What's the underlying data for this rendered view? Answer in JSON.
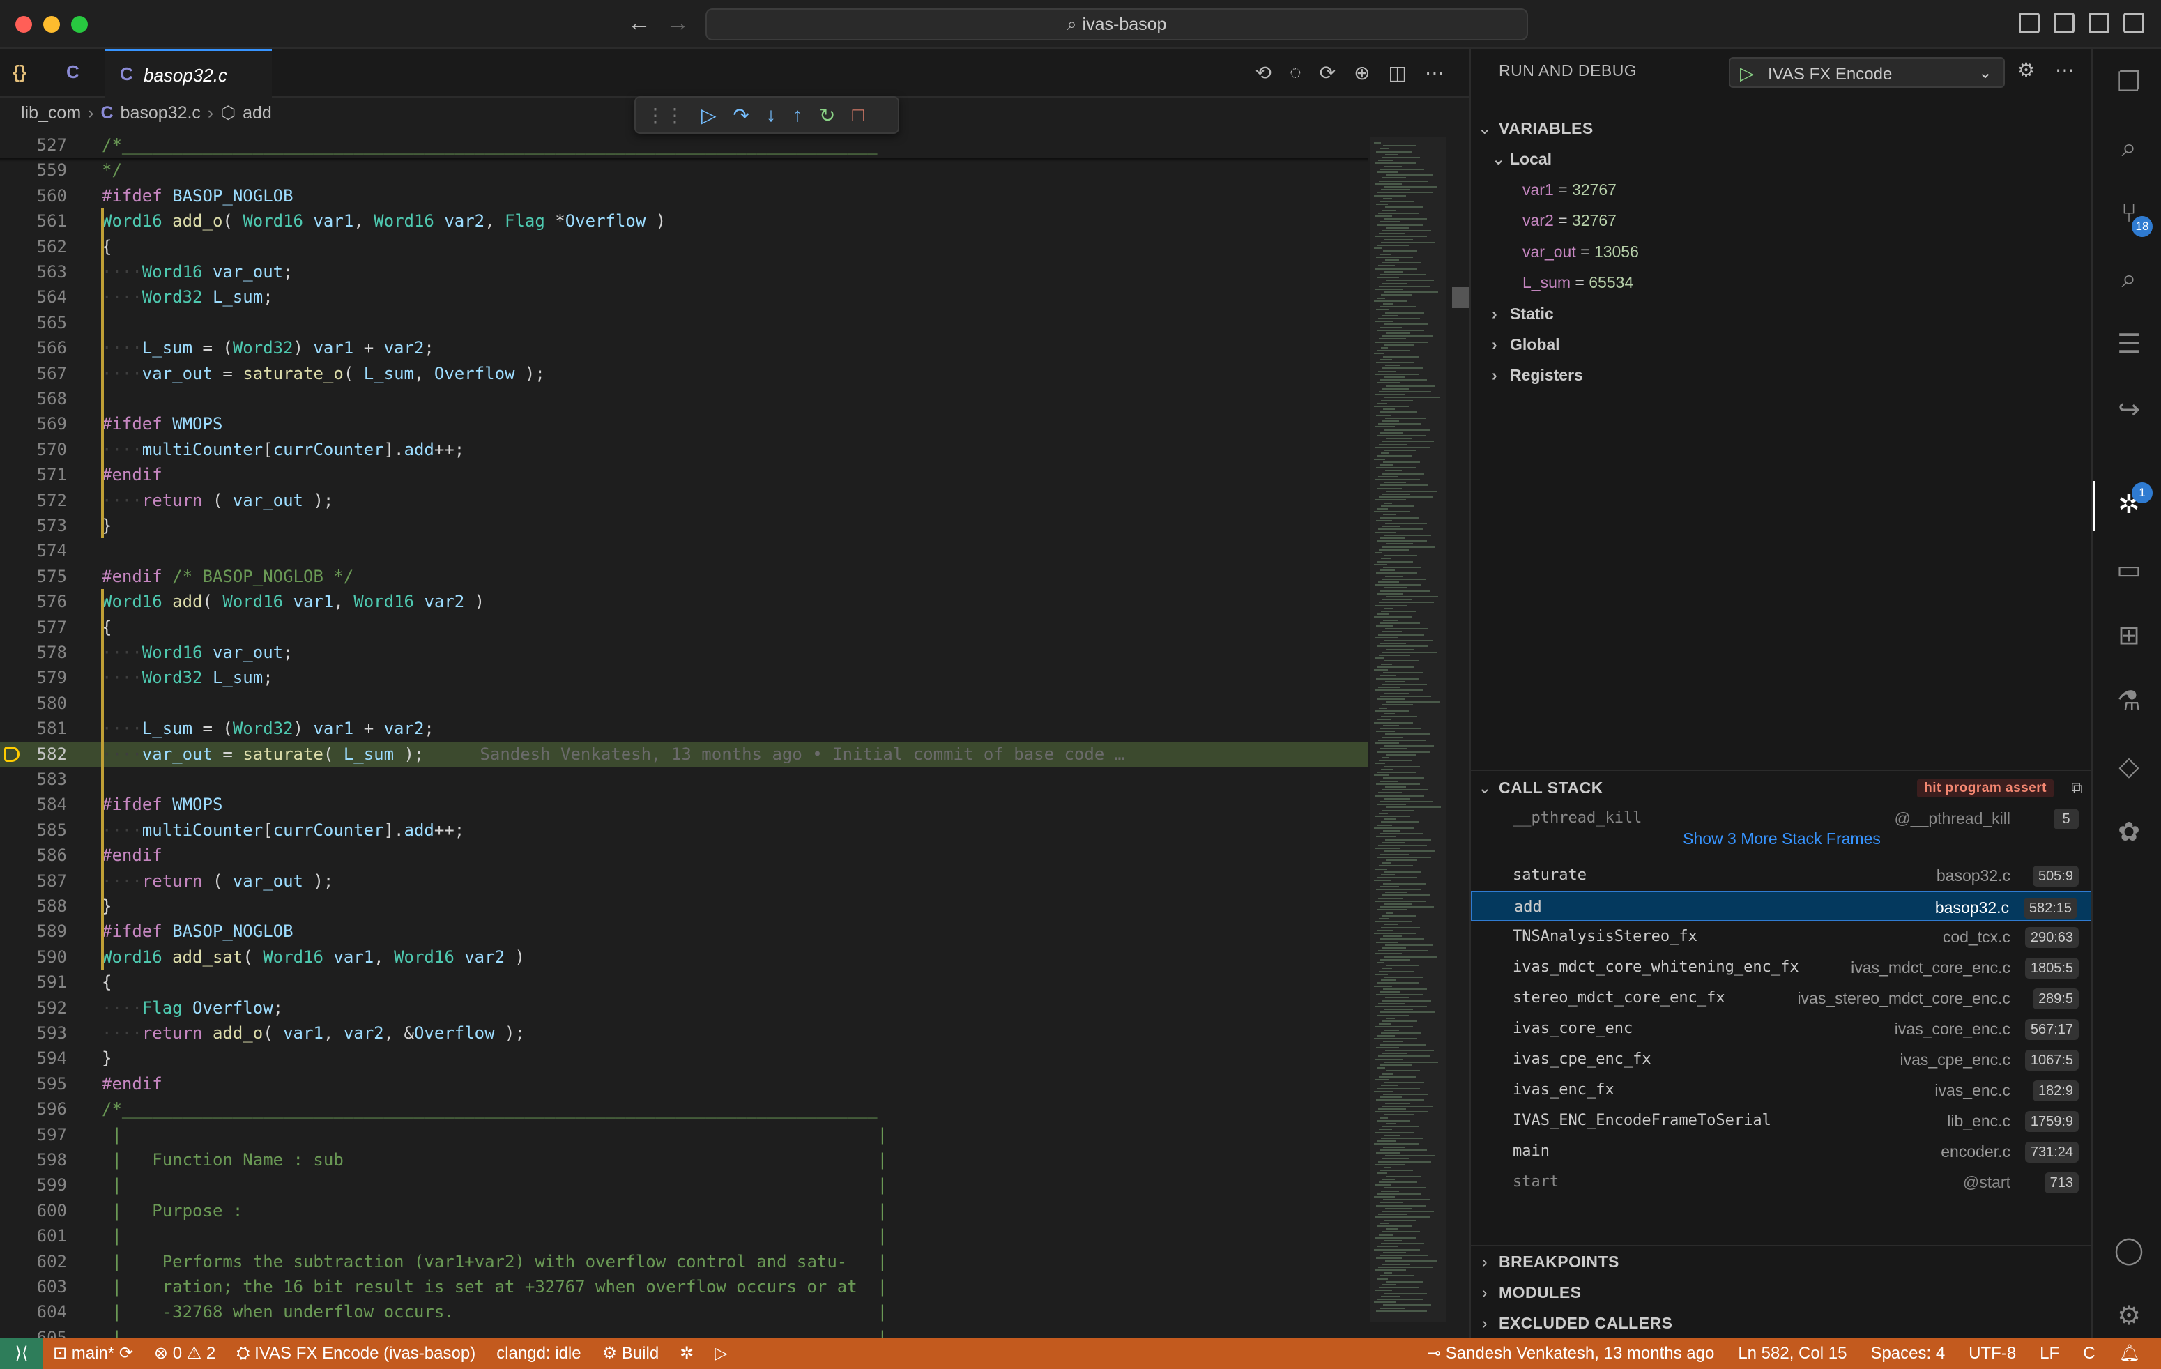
{
  "window": {
    "search_text": "ivas-basop"
  },
  "tabs": {
    "json_glyph": "{}",
    "c_glyph": "C",
    "active_label": "basop32.c"
  },
  "breadcrumb": {
    "folder": "lib_com",
    "file": "basop32.c",
    "symbol": "add"
  },
  "code": {
    "blame": "Sandesh Venkatesh, 13 months ago • Initial commit of base code …",
    "lines": [
      {
        "n": "527",
        "html": "<span class='cm'>/*___________________________________________________________________________</span>"
      },
      {
        "n": "559",
        "html": "<span class='cm'>*/</span>"
      },
      {
        "n": "560",
        "html": "<span class='pp'>#ifdef</span> <span class='id'>BASOP_NOGLOB</span>"
      },
      {
        "n": "561",
        "html": "<span class='ty'>Word16</span> <span class='fn'>add_o</span>( <span class='ty'>Word16</span> <span class='pa'>var1</span>, <span class='ty'>Word16</span> <span class='pa'>var2</span>, <span class='ty'>Flag</span> *<span class='pa'>Overflow</span> )"
      },
      {
        "n": "562",
        "html": "{"
      },
      {
        "n": "563",
        "html": "<span class='dots'>····</span><span class='ty'>Word16</span> <span class='id'>var_out</span>;"
      },
      {
        "n": "564",
        "html": "<span class='dots'>····</span><span class='ty'>Word32</span> <span class='id'>L_sum</span>;"
      },
      {
        "n": "565",
        "html": ""
      },
      {
        "n": "566",
        "html": "<span class='dots'>····</span><span class='id'>L_sum</span> = (<span class='ty'>Word32</span>) <span class='pa'>var1</span> + <span class='pa'>var2</span>;"
      },
      {
        "n": "567",
        "html": "<span class='dots'>····</span><span class='id'>var_out</span> = <span class='fn'>saturate_o</span>( <span class='id'>L_sum</span>, <span class='pa'>Overflow</span> );"
      },
      {
        "n": "568",
        "html": ""
      },
      {
        "n": "569",
        "html": "<span class='pp'>#ifdef</span> <span class='id'>WMOPS</span>"
      },
      {
        "n": "570",
        "html": "<span class='dots'>····</span><span class='id'>multiCounter</span>[<span class='id'>currCounter</span>].<span class='id'>add</span>++;"
      },
      {
        "n": "571",
        "html": "<span class='pp'>#endif</span>"
      },
      {
        "n": "572",
        "html": "<span class='dots'>····</span><span class='kw'>return</span> ( <span class='id'>var_out</span> );"
      },
      {
        "n": "573",
        "html": "}"
      },
      {
        "n": "574",
        "html": ""
      },
      {
        "n": "575",
        "html": "<span class='pp'>#endif</span> <span class='cm'>/* BASOP_NOGLOB */</span>"
      },
      {
        "n": "576",
        "html": "<span class='ty'>Word16</span> <span class='fn'>add</span>( <span class='ty'>Word16</span> <span class='pa'>var1</span>, <span class='ty'>Word16</span> <span class='pa'>var2</span> )"
      },
      {
        "n": "577",
        "html": "{"
      },
      {
        "n": "578",
        "html": "<span class='dots'>····</span><span class='ty'>Word16</span> <span class='id'>var_out</span>;"
      },
      {
        "n": "579",
        "html": "<span class='dots'>····</span><span class='ty'>Word32</span> <span class='id'>L_sum</span>;"
      },
      {
        "n": "580",
        "html": ""
      },
      {
        "n": "581",
        "html": "<span class='dots'>····</span><span class='id'>L_sum</span> = (<span class='ty'>Word32</span>) <span class='pa'>var1</span> + <span class='pa'>var2</span>;"
      },
      {
        "n": "582",
        "html": "<span class='dots'>····</span><span class='id'>var_out</span> = <span class='fn'>saturate</span>( <span class='id'>L_sum</span> );"
      },
      {
        "n": "583",
        "html": ""
      },
      {
        "n": "584",
        "html": "<span class='pp'>#ifdef</span> <span class='id'>WMOPS</span>"
      },
      {
        "n": "585",
        "html": "<span class='dots'>····</span><span class='id'>multiCounter</span>[<span class='id'>currCounter</span>].<span class='id'>add</span>++;"
      },
      {
        "n": "586",
        "html": "<span class='pp'>#endif</span>"
      },
      {
        "n": "587",
        "html": "<span class='dots'>····</span><span class='kw'>return</span> ( <span class='id'>var_out</span> );"
      },
      {
        "n": "588",
        "html": "}"
      },
      {
        "n": "589",
        "html": "<span class='pp'>#ifdef</span> <span class='id'>BASOP_NOGLOB</span>"
      },
      {
        "n": "590",
        "html": "<span class='ty'>Word16</span> <span class='fn'>add_sat</span>( <span class='ty'>Word16</span> <span class='pa'>var1</span>, <span class='ty'>Word16</span> <span class='pa'>var2</span> )"
      },
      {
        "n": "591",
        "html": "{"
      },
      {
        "n": "592",
        "html": "<span class='dots'>····</span><span class='ty'>Flag</span> <span class='id'>Overflow</span>;"
      },
      {
        "n": "593",
        "html": "<span class='dots'>····</span><span class='kw'>return</span> <span class='fn'>add_o</span>( <span class='pa'>var1</span>, <span class='pa'>var2</span>, &amp;<span class='id'>Overflow</span> );"
      },
      {
        "n": "594",
        "html": "}"
      },
      {
        "n": "595",
        "html": "<span class='pp'>#endif</span>"
      },
      {
        "n": "596",
        "html": "<span class='cm'>/*___________________________________________________________________________</span>"
      },
      {
        "n": "597",
        "html": "<span class='cm'> |                                                                           |</span>"
      },
      {
        "n": "598",
        "html": "<span class='cm'> |   Function Name : sub                                                     |</span>"
      },
      {
        "n": "599",
        "html": "<span class='cm'> |                                                                           |</span>"
      },
      {
        "n": "600",
        "html": "<span class='cm'> |   Purpose :                                                               |</span>"
      },
      {
        "n": "601",
        "html": "<span class='cm'> |                                                                           |</span>"
      },
      {
        "n": "602",
        "html": "<span class='cm'> |    Performs the subtraction (var1+var2) with overflow control and satu-   |</span>"
      },
      {
        "n": "603",
        "html": "<span class='cm'> |    ration; the 16 bit result is set at +32767 when overflow occurs or at  |</span>"
      },
      {
        "n": "604",
        "html": "<span class='cm'> |    -32768 when underflow occurs.                                          |</span>"
      },
      {
        "n": "605",
        "html": "<span class='cm'> |                                                                           |</span>"
      }
    ]
  },
  "debug_panel": {
    "title": "RUN AND DEBUG",
    "launch_config": "IVAS FX Encode",
    "variables_title": "VARIABLES",
    "local_label": "Local",
    "locals": [
      {
        "name": "var1",
        "value": "32767"
      },
      {
        "name": "var2",
        "value": "32767"
      },
      {
        "name": "var_out",
        "value": "13056"
      },
      {
        "name": "L_sum",
        "value": "65534"
      }
    ],
    "static_label": "Static",
    "global_label": "Global",
    "registers_label": "Registers",
    "callstack_title": "CALL STACK",
    "callstack_badge": "hit program assert",
    "show_more": "Show 3 More Stack Frames",
    "frames": [
      {
        "name": "__pthread_kill",
        "file": "@__pthread_kill",
        "pos": "5"
      },
      {
        "name": "saturate",
        "file": "basop32.c",
        "pos": "505:9"
      },
      {
        "name": "add",
        "file": "basop32.c",
        "pos": "582:15"
      },
      {
        "name": "TNSAnalysisStereo_fx",
        "file": "cod_tcx.c",
        "pos": "290:63"
      },
      {
        "name": "ivas_mdct_core_whitening_enc_fx",
        "file": "ivas_mdct_core_enc.c",
        "pos": "1805:5"
      },
      {
        "name": "stereo_mdct_core_enc_fx",
        "file": "ivas_stereo_mdct_core_enc.c",
        "pos": "289:5"
      },
      {
        "name": "ivas_core_enc",
        "file": "ivas_core_enc.c",
        "pos": "567:17"
      },
      {
        "name": "ivas_cpe_enc_fx",
        "file": "ivas_cpe_enc.c",
        "pos": "1067:5"
      },
      {
        "name": "ivas_enc_fx",
        "file": "ivas_enc.c",
        "pos": "182:9"
      },
      {
        "name": "IVAS_ENC_EncodeFrameToSerial",
        "file": "lib_enc.c",
        "pos": "1759:9"
      },
      {
        "name": "main",
        "file": "encoder.c",
        "pos": "731:24"
      },
      {
        "name": "start",
        "file": "@start",
        "pos": "713"
      }
    ],
    "breakpoints_title": "BREAKPOINTS",
    "modules_title": "MODULES",
    "excluded_title": "EXCLUDED CALLERS"
  },
  "activity": {
    "scm_badge": "18",
    "debug_badge": "1"
  },
  "statusbar": {
    "branch": "main*",
    "errors": "0",
    "warnings": "2",
    "launch": "IVAS FX Encode (ivas-basop)",
    "clangd": "clangd: idle",
    "build": "Build",
    "blame": "Sandesh Venkatesh, 13 months ago",
    "position": "Ln 582, Col 15",
    "spaces": "Spaces: 4",
    "encoding": "UTF-8",
    "eol": "LF",
    "language": "C"
  }
}
